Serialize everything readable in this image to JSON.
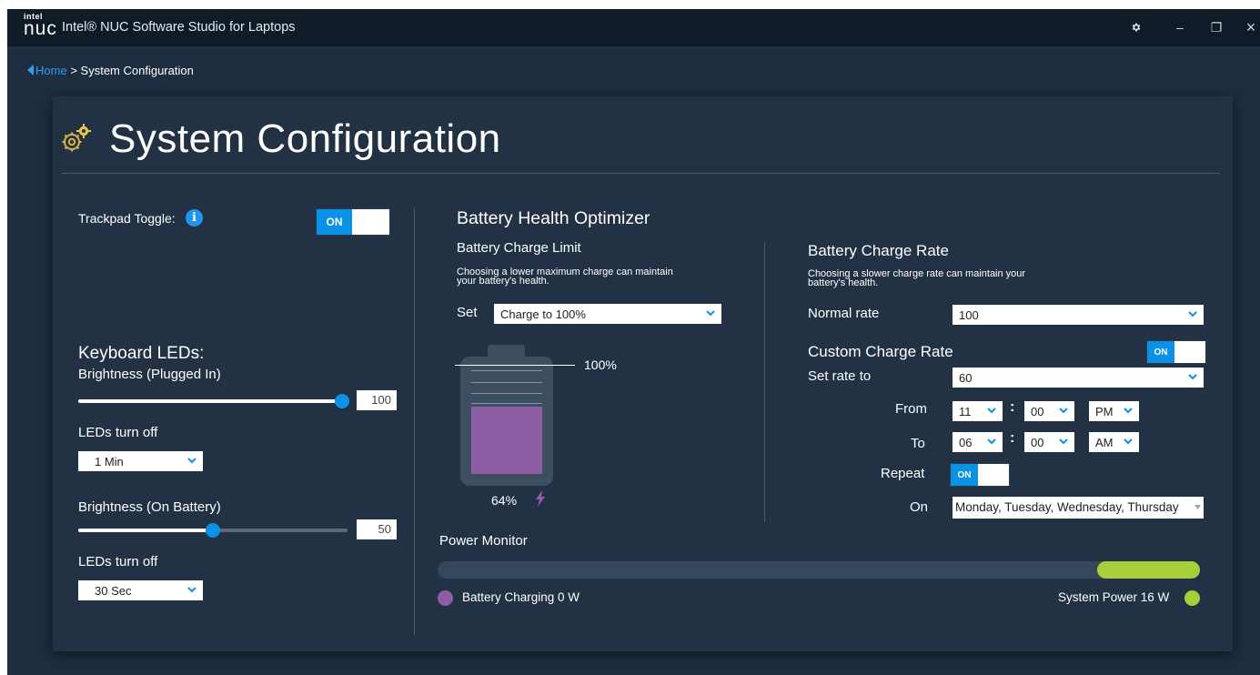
{
  "window": {
    "logo_top": "intel",
    "logo_bottom": "nuc",
    "title": "Intel® NUC Software Studio for Laptops",
    "settings_icon": "gear-icon",
    "minimize_glyph": "–",
    "restore_glyph": "❐",
    "close_glyph": "×"
  },
  "breadcrumb": {
    "home": "Home",
    "separator": ">",
    "current": "System Configuration"
  },
  "page": {
    "title": "System Configuration",
    "icon": "gears-icon"
  },
  "trackpad": {
    "label": "Trackpad Toggle:",
    "info_glyph": "i",
    "toggle_label": "ON",
    "toggle_on": true
  },
  "keyboard": {
    "heading": "Keyboard LEDs:",
    "plugged": {
      "label": "Brightness (Plugged In)",
      "value": "100",
      "slider_level": 100,
      "off_label": "LEDs turn off",
      "off_value": "1 Min"
    },
    "battery": {
      "label": "Brightness (On Battery)",
      "value": "50",
      "slider_level": 50,
      "off_label": "LEDs turn off",
      "off_value": "30 Sec"
    }
  },
  "health": {
    "heading": "Battery Health Optimizer",
    "limit": {
      "heading": "Battery Charge Limit",
      "desc_line1": "Choosing a lower maximum charge can maintain",
      "desc_line2": "your battery's health.",
      "set_label": "Set",
      "set_value": "Charge to 100%",
      "limit_marker": "100%",
      "charge_level": 64,
      "charge_text": "64%",
      "charging_icon": "lightning-icon"
    },
    "rate": {
      "heading": "Battery Charge Rate",
      "desc_line1": "Choosing a slower charge rate can maintain your",
      "desc_line2": "battery's health.",
      "normal_label": "Normal rate",
      "normal_value": "100",
      "custom_label": "Custom Charge Rate",
      "custom_toggle": "ON",
      "set_rate_label": "Set rate to",
      "set_rate_value": "60",
      "from_label": "From",
      "from_hour": "11",
      "from_min": "00",
      "from_ampm": "PM",
      "to_label": "To",
      "to_hour": "06",
      "to_min": "00",
      "to_ampm": "AM",
      "time_sep": ":",
      "repeat_label": "Repeat",
      "repeat_toggle": "ON",
      "on_label": "On",
      "on_value": "Monday, Tuesday, Wednesday, Thursday"
    }
  },
  "power_monitor": {
    "heading": "Power Monitor",
    "battery_label": "Battery Charging 0 W",
    "system_label": "System Power 16 W",
    "system_share": 0.135
  },
  "colors": {
    "accent": "#0a92e6",
    "battery_fill": "#8e5ea4",
    "system_power": "#a9ce3c",
    "charging_icon": "#9b59b6"
  }
}
